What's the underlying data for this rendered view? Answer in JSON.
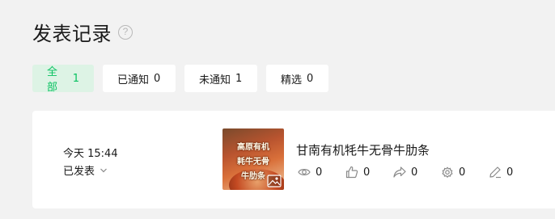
{
  "header": {
    "title": "发表记录",
    "help_icon": "?"
  },
  "filters": [
    {
      "label": "全部",
      "count": "1",
      "active": true
    },
    {
      "label": "已通知",
      "count": "0",
      "active": false
    },
    {
      "label": "未通知",
      "count": "1",
      "active": false
    },
    {
      "label": "精选",
      "count": "0",
      "active": false
    }
  ],
  "record": {
    "time": "今天 15:44",
    "status": "已发表",
    "thumbnail_text": [
      "高原有机",
      "耗牛无骨",
      "牛肋条"
    ],
    "title": "甘南有机牦牛无骨牛肋条",
    "stats": {
      "views": "0",
      "likes": "0",
      "shares": "0",
      "recommends": "0",
      "comments": "0"
    }
  },
  "colors": {
    "accent": "#07c160",
    "active_tab_bg": "#ddf3e5",
    "page_bg": "#f2f2f2",
    "icon_gray": "#8a8a8a"
  },
  "icons": [
    "help-icon",
    "chevron-down-icon",
    "eye-icon",
    "thumbs-up-icon",
    "share-icon",
    "gear-icon",
    "pencil-icon",
    "image-icon"
  ]
}
